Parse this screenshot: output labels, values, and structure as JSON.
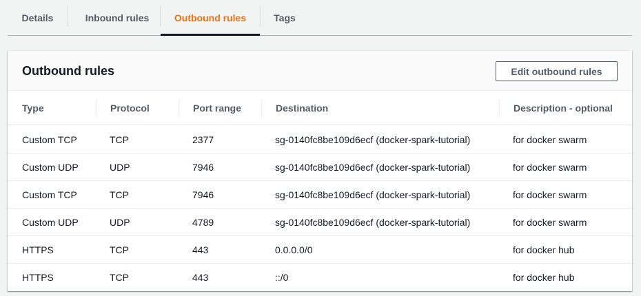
{
  "tabs": [
    {
      "label": "Details"
    },
    {
      "label": "Inbound rules"
    },
    {
      "label": "Outbound rules"
    },
    {
      "label": "Tags"
    }
  ],
  "active_tab": "Outbound rules",
  "panel": {
    "title": "Outbound rules",
    "edit_button": "Edit outbound rules"
  },
  "table": {
    "columns": [
      "Type",
      "Protocol",
      "Port range",
      "Destination",
      "Description - optional"
    ],
    "rows": [
      [
        "Custom TCP",
        "TCP",
        "2377",
        "sg-0140fc8be109d6ecf (docker-spark-tutorial)",
        "for docker swarm"
      ],
      [
        "Custom UDP",
        "UDP",
        "7946",
        "sg-0140fc8be109d6ecf (docker-spark-tutorial)",
        "for docker swarm"
      ],
      [
        "Custom TCP",
        "TCP",
        "7946",
        "sg-0140fc8be109d6ecf (docker-spark-tutorial)",
        "for docker swarm"
      ],
      [
        "Custom UDP",
        "UDP",
        "4789",
        "sg-0140fc8be109d6ecf (docker-spark-tutorial)",
        "for docker swarm"
      ],
      [
        "HTTPS",
        "TCP",
        "443",
        "0.0.0.0/0",
        "for docker hub"
      ],
      [
        "HTTPS",
        "TCP",
        "443",
        "::/0",
        "for docker hub"
      ]
    ]
  },
  "colors": {
    "accent": "#ec7211",
    "text": "#16191f",
    "muted": "#545b64"
  }
}
